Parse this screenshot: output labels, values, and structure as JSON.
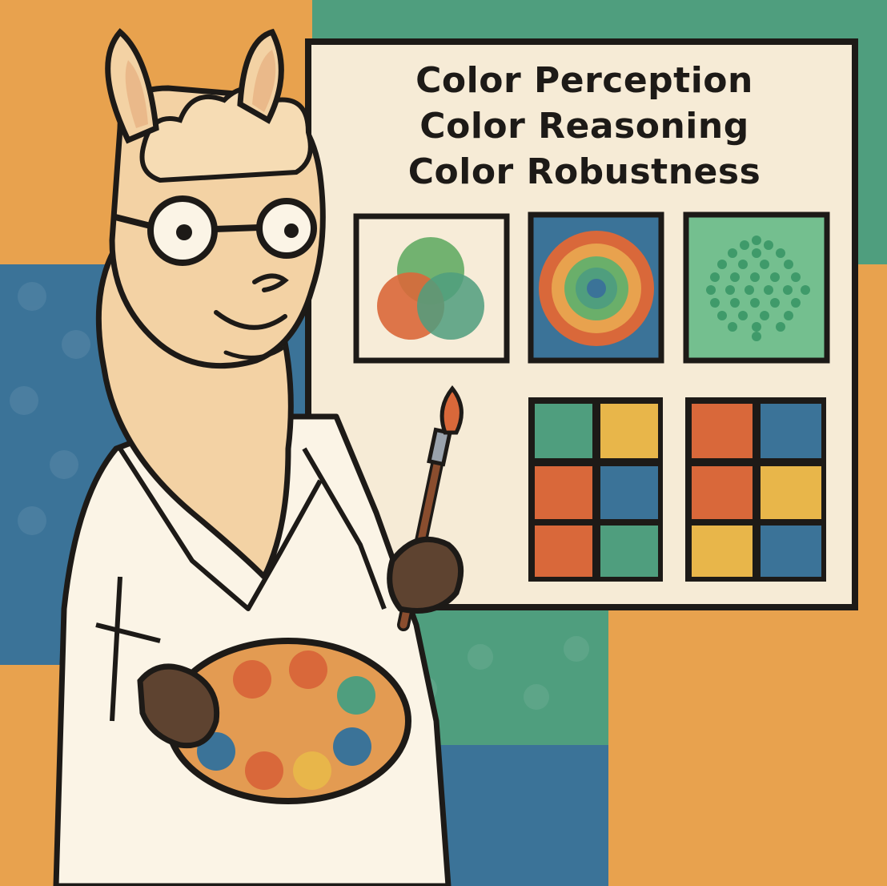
{
  "board": {
    "lines": [
      "Color Perception",
      "Color Reasoning",
      "Color Robustness"
    ]
  },
  "palette": {
    "orange": "#e8a24e",
    "teal": "#4f9e7e",
    "blue": "#3b7398",
    "paper": "#f6ebd6",
    "ink": "#1d1a17",
    "red_orange": "#d9683a",
    "yellow": "#e8b64a",
    "green": "#6aaf6a",
    "fleece": "#f3d2a4",
    "glove": "#5e4330"
  },
  "illustration": {
    "subject": "llama-scientist",
    "items": [
      "lab-coat",
      "glasses",
      "paint-palette",
      "paintbrush",
      "whiteboard"
    ]
  }
}
